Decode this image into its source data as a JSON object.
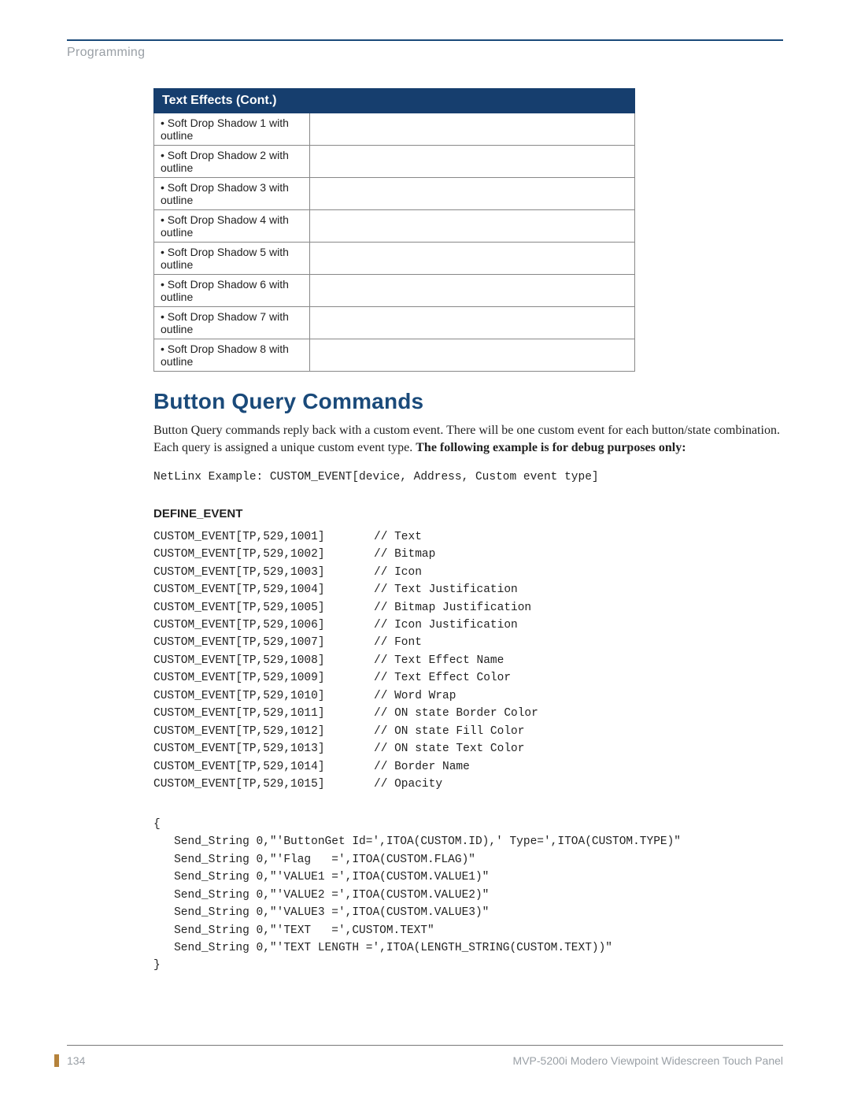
{
  "header": {
    "section_label": "Programming"
  },
  "table": {
    "title": "Text Effects (Cont.)",
    "rows": [
      "Soft Drop Shadow 1 with outline",
      "Soft Drop Shadow 2 with outline",
      "Soft Drop Shadow 3 with outline",
      "Soft Drop Shadow 4 with outline",
      "Soft Drop Shadow 5 with outline",
      "Soft Drop Shadow 6 with outline",
      "Soft Drop Shadow 7 with outline",
      "Soft Drop Shadow 8 with outline"
    ]
  },
  "section": {
    "title": "Button Query Commands",
    "intro_plain": "Button Query commands reply back with a custom event. There will be one custom event for each button/state combination. Each query is assigned a unique custom event type. ",
    "intro_bold": "The following example is for debug purposes only:",
    "netlinx_example": "NetLinx Example: CUSTOM_EVENT[device, Address, Custom event type]",
    "define_event_label": "DEFINE_EVENT",
    "events": [
      {
        "cmd": "CUSTOM_EVENT[TP,529,1001]",
        "comment": "// Text"
      },
      {
        "cmd": "CUSTOM_EVENT[TP,529,1002]",
        "comment": "// Bitmap"
      },
      {
        "cmd": "CUSTOM_EVENT[TP,529,1003]",
        "comment": "// Icon"
      },
      {
        "cmd": "CUSTOM_EVENT[TP,529,1004]",
        "comment": "// Text Justification"
      },
      {
        "cmd": "CUSTOM_EVENT[TP,529,1005]",
        "comment": "// Bitmap Justification"
      },
      {
        "cmd": "CUSTOM_EVENT[TP,529,1006]",
        "comment": "// Icon Justification"
      },
      {
        "cmd": "CUSTOM_EVENT[TP,529,1007]",
        "comment": "// Font"
      },
      {
        "cmd": "CUSTOM_EVENT[TP,529,1008]",
        "comment": "// Text Effect Name"
      },
      {
        "cmd": "CUSTOM_EVENT[TP,529,1009]",
        "comment": "// Text Effect Color"
      },
      {
        "cmd": "CUSTOM_EVENT[TP,529,1010]",
        "comment": "// Word Wrap"
      },
      {
        "cmd": "CUSTOM_EVENT[TP,529,1011]",
        "comment": "// ON state Border Color"
      },
      {
        "cmd": "CUSTOM_EVENT[TP,529,1012]",
        "comment": "// ON state Fill Color"
      },
      {
        "cmd": "CUSTOM_EVENT[TP,529,1013]",
        "comment": "// ON state Text Color"
      },
      {
        "cmd": "CUSTOM_EVENT[TP,529,1014]",
        "comment": "// Border Name"
      },
      {
        "cmd": "CUSTOM_EVENT[TP,529,1015]",
        "comment": "// Opacity"
      }
    ],
    "code_block": "{\n   Send_String 0,\"'ButtonGet Id=',ITOA(CUSTOM.ID),' Type=',ITOA(CUSTOM.TYPE)\"\n   Send_String 0,\"'Flag   =',ITOA(CUSTOM.FLAG)\"\n   Send_String 0,\"'VALUE1 =',ITOA(CUSTOM.VALUE1)\"\n   Send_String 0,\"'VALUE2 =',ITOA(CUSTOM.VALUE2)\"\n   Send_String 0,\"'VALUE3 =',ITOA(CUSTOM.VALUE3)\"\n   Send_String 0,\"'TEXT   =',CUSTOM.TEXT\"\n   Send_String 0,\"'TEXT LENGTH =',ITOA(LENGTH_STRING(CUSTOM.TEXT))\"\n}"
  },
  "footer": {
    "page_number": "134",
    "doc_title": "MVP-5200i Modero Viewpoint Widescreen Touch Panel"
  }
}
